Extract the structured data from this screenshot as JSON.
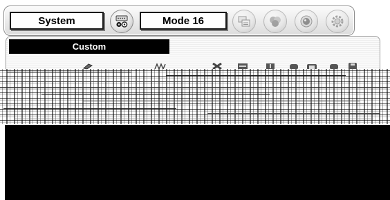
{
  "menu": {
    "system_label": "System",
    "mode_label": "Mode 16",
    "buttons": [
      {
        "icon": "input-connector-icon"
      },
      {
        "icon": "pc-adjust-icon"
      },
      {
        "icon": "image-color-icon"
      },
      {
        "icon": "screen-lens-icon"
      },
      {
        "icon": "setting-gear-icon"
      }
    ]
  },
  "submenu": {
    "title": "Custom",
    "tools": [
      "fine-sync-icon",
      "total-dots-icon",
      "close-x-icon",
      "horizontal-position-icon",
      "vertical-position-icon",
      "current-mode-icon",
      "clamp-icon",
      "display-area-icon",
      "store-icon"
    ]
  },
  "colors": {
    "highlight_bg": "#000000",
    "highlight_text": "#ffffff"
  }
}
